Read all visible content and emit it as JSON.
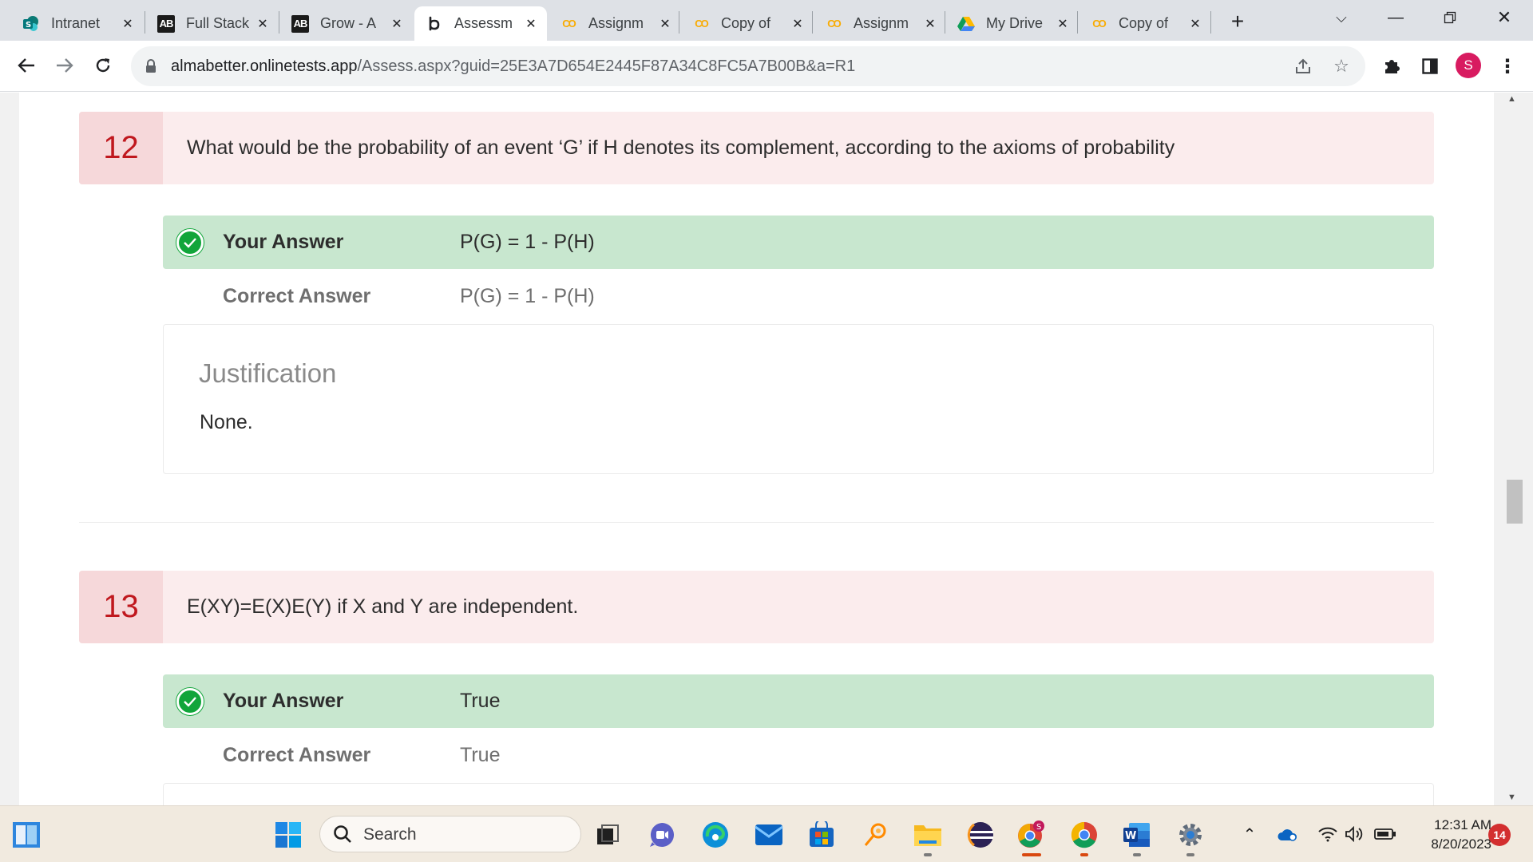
{
  "browser": {
    "tabs": [
      {
        "title": "Intranet",
        "favicon": "sharepoint-icon"
      },
      {
        "title": "Full Stack",
        "favicon": "ab-icon"
      },
      {
        "title": "Grow - A",
        "favicon": "ab-icon"
      },
      {
        "title": "Assessm",
        "favicon": "assessment-icon",
        "active": true
      },
      {
        "title": "Assignm",
        "favicon": "colab-icon"
      },
      {
        "title": "Copy of",
        "favicon": "colab-icon"
      },
      {
        "title": "Assignm",
        "favicon": "colab-icon"
      },
      {
        "title": "My Drive",
        "favicon": "google-drive-icon"
      },
      {
        "title": "Copy of",
        "favicon": "colab-icon"
      }
    ],
    "url_host": "almabetter.onlinetests.app",
    "url_path": "/Assess.aspx?guid=25E3A7D654E2445F87A34C8FC5A7B00B&a=R1",
    "profile_initial": "S"
  },
  "questions": [
    {
      "number": "12",
      "text": "What would be the probability of an event ‘G’ if H denotes its complement, according to the axioms of probability",
      "your_answer_label": "Your Answer",
      "your_answer": "P(G) = 1 - P(H)",
      "correct_answer_label": "Correct Answer",
      "correct_answer": "P(G) = 1 - P(H)",
      "justification_title": "Justification",
      "justification": "None."
    },
    {
      "number": "13",
      "text": "E(XY)=E(X)E(Y) if X and Y are independent.",
      "your_answer_label": "Your Answer",
      "your_answer": "True",
      "correct_answer_label": "Correct Answer",
      "correct_answer": "True"
    }
  ],
  "taskbar": {
    "search_placeholder": "Search",
    "time": "12:31 AM",
    "date": "8/20/2023",
    "notification_count": "14",
    "chrome_badge": "S"
  },
  "colors": {
    "question_bg": "#fbeced",
    "question_num_bg": "#f6d8da",
    "question_num": "#c0181e",
    "answer_bg": "#c8e7cf",
    "check": "#11a53a"
  }
}
